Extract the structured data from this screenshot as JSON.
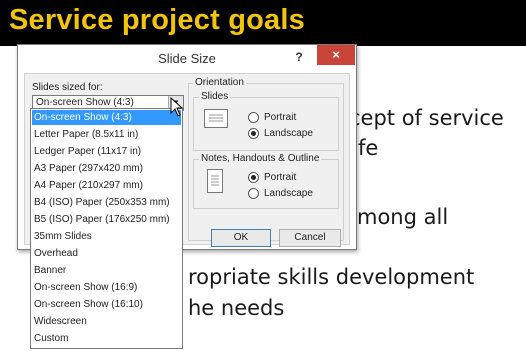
{
  "slide": {
    "title": "Service project goals",
    "lines": [
      "cept of service",
      "fe",
      "mong all",
      "ropriate skills development",
      "he needs"
    ]
  },
  "dialog": {
    "title": "Slide Size",
    "help": "?",
    "close": "×",
    "sized_for_label": "Slides sized for:",
    "selected_value": "On-screen Show (4:3)",
    "orientation_label": "Orientation",
    "slides_group": {
      "label": "Slides",
      "portrait": "Portrait",
      "landscape": "Landscape",
      "selected": "landscape"
    },
    "notes_group": {
      "label": "Notes, Handouts & Outline",
      "portrait": "Portrait",
      "landscape": "Landscape",
      "selected": "portrait"
    },
    "ok_label": "OK",
    "cancel_label": "Cancel"
  },
  "dropdown": {
    "items": [
      "On-screen Show (4:3)",
      "Letter Paper (8.5x11 in)",
      "Ledger Paper (11x17 in)",
      "A3 Paper (297x420 mm)",
      "A4 Paper (210x297 mm)",
      "B4 (ISO) Paper (250x353 mm)",
      "B5 (ISO) Paper (176x250 mm)",
      "35mm Slides",
      "Overhead",
      "Banner",
      "On-screen Show (16:9)",
      "On-screen Show (16:10)",
      "Widescreen",
      "Custom"
    ],
    "selected_index": 0
  },
  "colors": {
    "title_text": "#f2c40a",
    "title_bar": "#000000",
    "close_button": "#c9453a",
    "selection": "#3399ff"
  }
}
